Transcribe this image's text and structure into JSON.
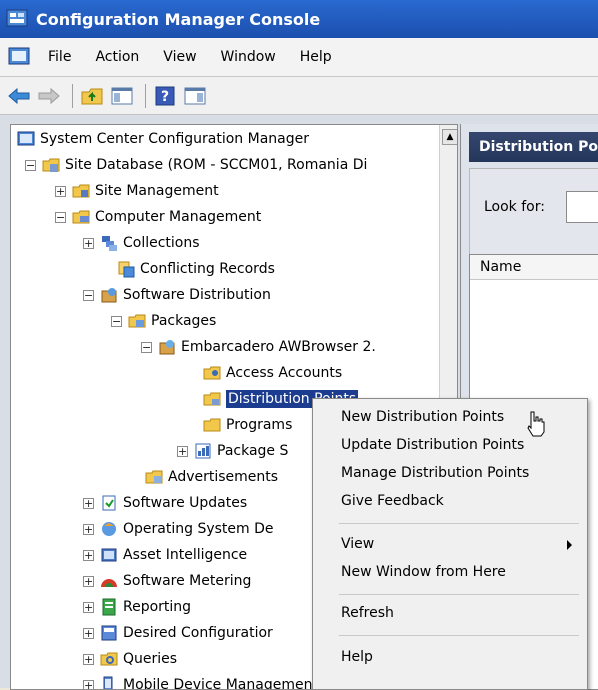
{
  "window": {
    "title": "Configuration Manager Console"
  },
  "menubar": {
    "items": [
      "File",
      "Action",
      "View",
      "Window",
      "Help"
    ]
  },
  "tree": {
    "nodes": [
      {
        "label": "System Center Configuration Manager"
      },
      {
        "label": "Site Database  (ROM - SCCM01, Romania Di"
      },
      {
        "label": "Site Management"
      },
      {
        "label": "Computer Management"
      },
      {
        "label": "Collections"
      },
      {
        "label": "Conflicting Records"
      },
      {
        "label": "Software Distribution"
      },
      {
        "label": "Packages"
      },
      {
        "label": "Embarcadero AWBrowser 2."
      },
      {
        "label": "Access Accounts"
      },
      {
        "label": "Distribution Points"
      },
      {
        "label": "Programs"
      },
      {
        "label": "Package S"
      },
      {
        "label": "Advertisements"
      },
      {
        "label": "Software Updates"
      },
      {
        "label": "Operating System De"
      },
      {
        "label": "Asset Intelligence"
      },
      {
        "label": "Software Metering"
      },
      {
        "label": "Reporting"
      },
      {
        "label": "Desired Configuratior"
      },
      {
        "label": "Queries"
      },
      {
        "label": "Mobile Device Management"
      }
    ]
  },
  "right_pane": {
    "header": "Distribution Po",
    "look_for_label": "Look for:",
    "name_column": "Name"
  },
  "context_menu": {
    "items": [
      "New Distribution Points",
      "Update Distribution Points",
      "Manage Distribution Points",
      "Give Feedback",
      "View",
      "New Window from Here",
      "Refresh",
      "Help"
    ]
  },
  "colors": {
    "title_bar": "#2a6ad0",
    "selection": "#1b3c8f",
    "menu_bg": "#f0f0f0"
  }
}
